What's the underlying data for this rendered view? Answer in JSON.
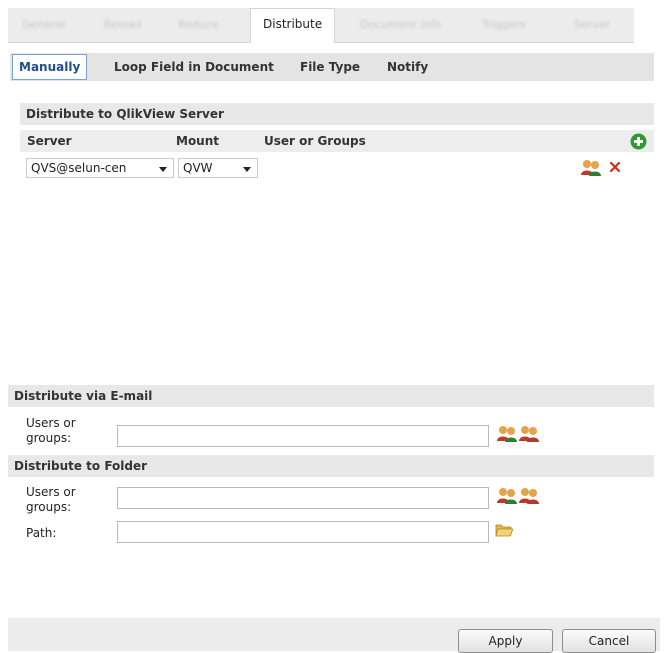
{
  "top_tabs": {
    "blurred_1": "General",
    "blurred_2": "Reload",
    "blurred_3": "Reduce",
    "active": "Distribute",
    "blurred_5": "Document Info",
    "blurred_6": "Triggers",
    "blurred_7": "Server"
  },
  "sub_tabs": {
    "manually": "Manually",
    "loop_field": "Loop Field in Document",
    "file_type": "File Type",
    "notify": "Notify"
  },
  "qlikview_server": {
    "title": "Distribute to QlikView Server",
    "columns": {
      "server": "Server",
      "mount": "Mount",
      "users": "User or Groups"
    },
    "row": {
      "server": "QVS@selun-cen",
      "mount": "QVW"
    }
  },
  "email": {
    "title": "Distribute via E-mail",
    "users_label_1": "Users or",
    "users_label_2": "groups:"
  },
  "folder": {
    "title": "Distribute to Folder",
    "users_label_1": "Users or",
    "users_label_2": "groups:",
    "path_label": "Path:"
  },
  "buttons": {
    "apply": "Apply",
    "cancel": "Cancel"
  },
  "colors": {
    "add_green": "#2e9b2e",
    "remove_red": "#d6291f",
    "link_blue": "#1f4e91"
  },
  "icons": [
    "add-icon",
    "users-icon",
    "remove-icon",
    "add-users-icon",
    "remove-users-icon",
    "folder-icon"
  ]
}
